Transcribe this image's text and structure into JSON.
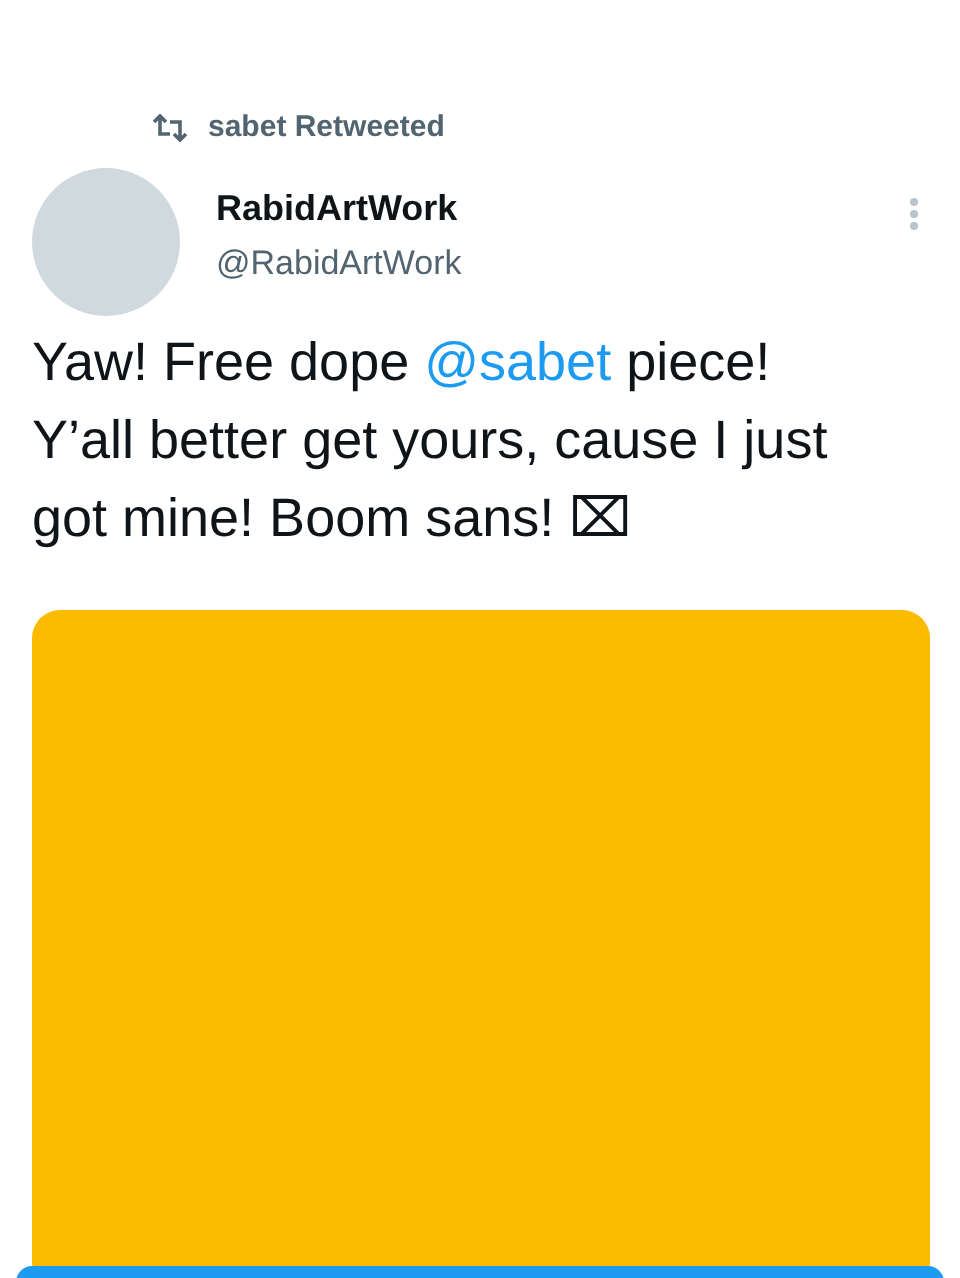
{
  "retweet": {
    "label": "sabet Retweeted"
  },
  "author": {
    "name": "RabidArtWork",
    "handle": "@RabidArtWork"
  },
  "tweet": {
    "parts": [
      {
        "kind": "text",
        "text": "Yaw! Free dope "
      },
      {
        "kind": "mention",
        "text": "@sabet"
      },
      {
        "kind": "text",
        "text": " piece! Y’all better get yours, cause I just got mine! Boom sans! ⌧"
      }
    ]
  }
}
